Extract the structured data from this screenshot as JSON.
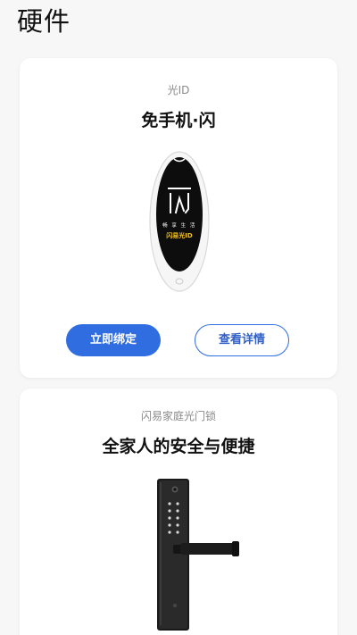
{
  "header": {
    "title": "硬件"
  },
  "cards": [
    {
      "subtitle": "光ID",
      "heading": "免手机·闪",
      "device": {
        "icon": "light-id-fob-icon",
        "slogan": "畅 享 生 活",
        "brand": "闪易光ID"
      },
      "buttons": {
        "primary": "立即绑定",
        "secondary": "查看详情"
      }
    },
    {
      "subtitle": "闪易家庭光门锁",
      "heading": "全家人的安全与便捷",
      "device": {
        "icon": "smart-door-lock-icon"
      }
    }
  ],
  "colors": {
    "primary": "#2f6de0",
    "outline_text": "#2f5fc7",
    "background": "#f7f7f7",
    "card": "#ffffff",
    "brand_yellow": "#f4c21c"
  }
}
